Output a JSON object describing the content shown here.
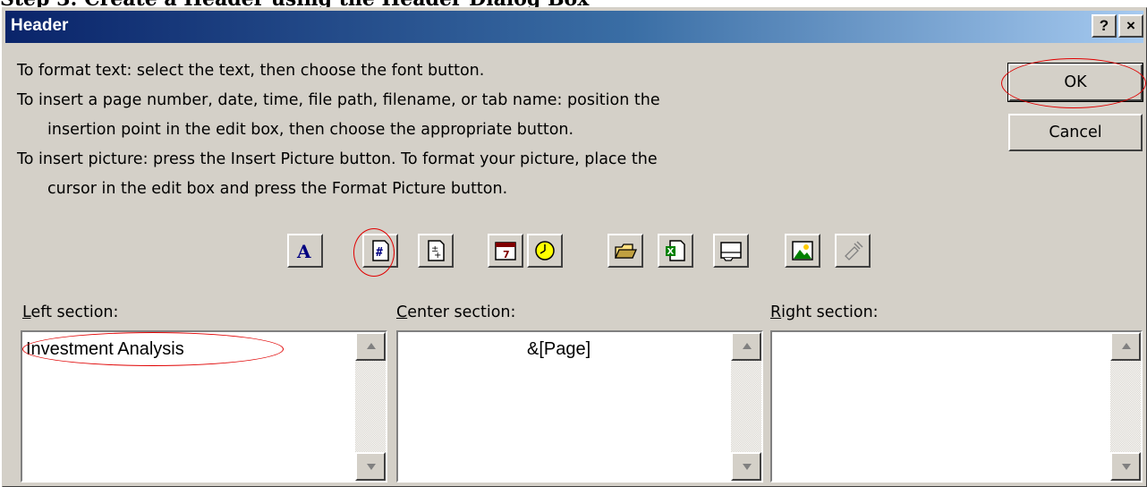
{
  "background_text": "Step 3: Create a Header using the Header Dialog Box",
  "dialog": {
    "title": "Header",
    "help_button": "?",
    "close_button": "×",
    "instructions": [
      "To format text:  select the text, then choose the font button.",
      "To insert a page number, date, time, file path, filename, or tab name:  position the",
      "insertion point in the edit box, then choose the appropriate button.",
      "To insert picture: press the Insert Picture button.  To format your picture, place the",
      "cursor in the edit box and press the Format Picture button."
    ],
    "ok_label": "OK",
    "cancel_label": "Cancel"
  },
  "toolbar": [
    {
      "name": "font-button",
      "icon": "font-icon"
    },
    {
      "name": "insert-page-number-button",
      "icon": "page-number-icon"
    },
    {
      "name": "insert-number-of-pages-button",
      "icon": "number-of-pages-icon"
    },
    {
      "name": "insert-date-button",
      "icon": "calendar-icon"
    },
    {
      "name": "insert-time-button",
      "icon": "clock-icon"
    },
    {
      "name": "insert-file-path-button",
      "icon": "folder-icon"
    },
    {
      "name": "insert-filename-button",
      "icon": "excel-file-icon"
    },
    {
      "name": "insert-sheet-name-button",
      "icon": "sheet-tab-icon"
    },
    {
      "name": "insert-picture-button",
      "icon": "picture-icon"
    },
    {
      "name": "format-picture-button",
      "icon": "format-picture-icon",
      "disabled": true
    }
  ],
  "sections": {
    "left": {
      "label_accel": "L",
      "label_rest": "eft section:",
      "value": "Investment Analysis"
    },
    "center": {
      "label_accel": "C",
      "label_rest": "enter section:",
      "value": "&[Page]"
    },
    "right": {
      "label_accel": "R",
      "label_rest": "ight section:",
      "value": ""
    }
  },
  "annotation_color": "#e00000"
}
